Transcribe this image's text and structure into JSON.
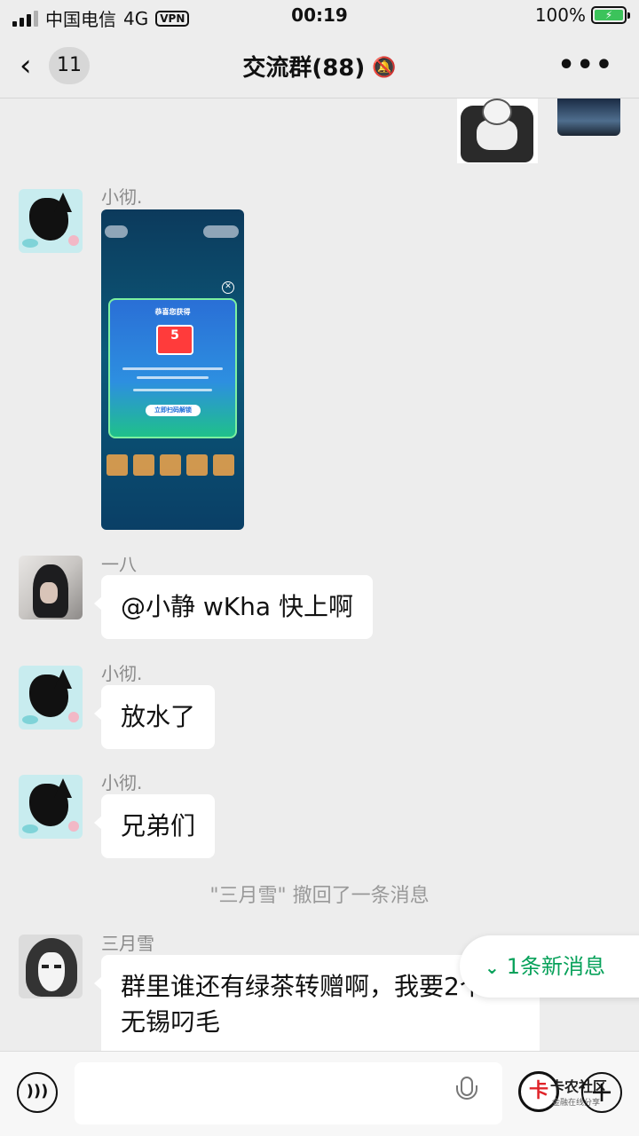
{
  "status_bar": {
    "carrier": "中国电信",
    "network": "4G",
    "vpn": "VPN",
    "time": "00:19",
    "battery": "100%"
  },
  "header": {
    "back_unread_count": "11",
    "title": "交流群(88)"
  },
  "messages": [
    {
      "sender": "小彻."
    },
    {
      "sender": "一八",
      "text": "@小静 wKha 快上啊"
    },
    {
      "sender": "小彻.",
      "text": "放水了"
    },
    {
      "sender": "小彻.",
      "text": "兄弟们"
    },
    {
      "system": "\"三月雪\" 撤回了一条消息"
    },
    {
      "sender": "三月雪",
      "text_line1": "群里谁还有绿茶转赠啊，我要2个",
      "text_line2": "无锡叼毛"
    }
  ],
  "screenshot_content": {
    "card_title": "恭喜您获得",
    "coupon_value": "5",
    "button_label": "立即扫码解锁"
  },
  "new_message_pill": "1条新消息",
  "watermark": {
    "logo_text": "卡",
    "name": "卡农社区",
    "sub": "金融在线分享"
  },
  "icons": {
    "back": "chevron-left-icon",
    "mute": "bell-slash-icon",
    "more": "more-dots-icon",
    "voice": "voice-icon",
    "mic": "microphone-icon",
    "plus": "plus-icon",
    "new_msg": "double-chevron-down-icon"
  },
  "colors": {
    "background": "#ededed",
    "bubble": "#ffffff",
    "accent_green": "#07a15a"
  }
}
